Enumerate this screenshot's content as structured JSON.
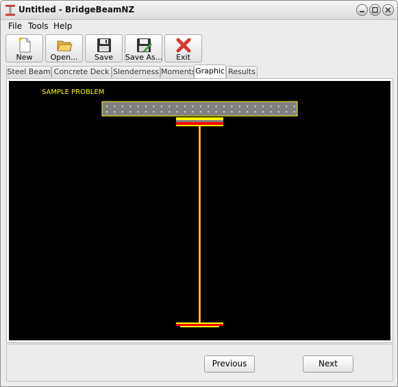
{
  "window": {
    "title": "Untitled - BridgeBeamNZ"
  },
  "menu": [
    "File",
    "Tools",
    "Help"
  ],
  "toolbar": {
    "new_label": "New",
    "open_label": "Open...",
    "save_label": "Save",
    "save_as_label": "Save As...",
    "exit_label": "Exit"
  },
  "tabs": [
    "Steel Beam",
    "Concrete Deck",
    "Slenderness",
    "Moments",
    "Graphic",
    "Results"
  ],
  "active_tab": "Graphic",
  "graphic": {
    "problem_label": "SAMPLE PROBLEM"
  },
  "colors": {
    "canvas_bg": "#000000",
    "label_yellow": "#ffff00",
    "deck_fill": "#808080",
    "deck_outline": "#ffff00",
    "flange_red": "#ff0000",
    "flange_yellow": "#ffff00",
    "web": "#ff8040"
  },
  "navigation": {
    "previous_label": "Previous",
    "next_label": "Next"
  }
}
